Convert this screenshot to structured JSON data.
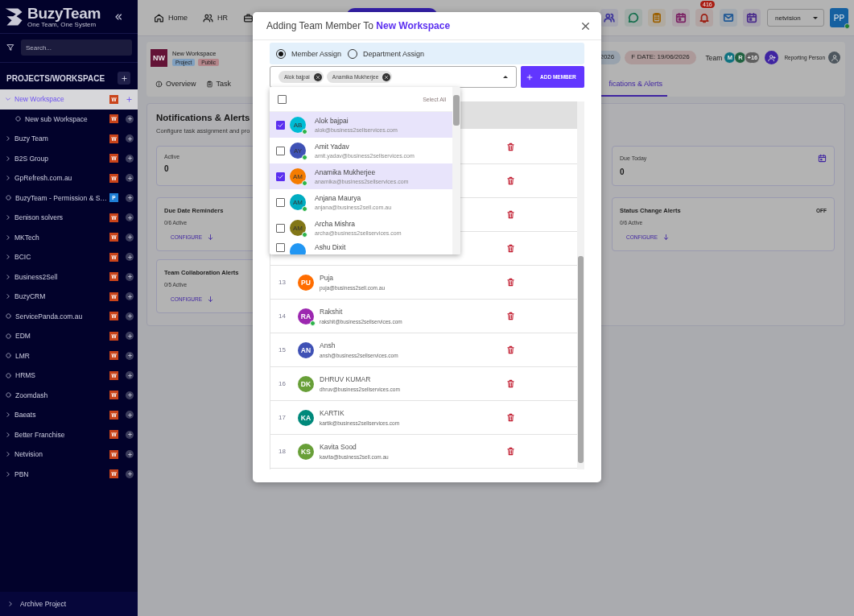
{
  "sidebar": {
    "logo_title": "BuzyTeam",
    "logo_tagline": "One Team, One System",
    "search_placeholder": "Search...",
    "section_title": "PROJECTS/WORKSPACE",
    "items": [
      {
        "kind": "folder",
        "label": "New Workspace",
        "expanded": true,
        "selected": true,
        "badge": "W",
        "color": "#c9441a",
        "children": [
          {
            "kind": "dot",
            "label": "New sub Workspace",
            "selected": false,
            "badge": "W",
            "color": "#c9441a"
          }
        ]
      },
      {
        "kind": "folder",
        "label": "Buzy Team",
        "expanded": false,
        "selected": false,
        "badge": "W",
        "color": "#c9441a"
      },
      {
        "kind": "folder",
        "label": "B2S Group",
        "expanded": false,
        "selected": false,
        "badge": "W",
        "color": "#c9441a"
      },
      {
        "kind": "folder",
        "label": "GpRefresh.com.au",
        "expanded": false,
        "selected": false,
        "badge": "W",
        "color": "#c9441a"
      },
      {
        "kind": "dot",
        "label": "BuzyTeam - Permission & S…",
        "selected": false,
        "badge": "P",
        "color": "#1f7fd6"
      },
      {
        "kind": "folder",
        "label": "Benison solvers",
        "expanded": false,
        "selected": false,
        "badge": "W",
        "color": "#c9441a"
      },
      {
        "kind": "folder",
        "label": "MKTech",
        "expanded": false,
        "selected": false,
        "badge": "W",
        "color": "#c9441a"
      },
      {
        "kind": "folder",
        "label": "BCIC",
        "expanded": false,
        "selected": false,
        "badge": "W",
        "color": "#c9441a"
      },
      {
        "kind": "folder",
        "label": "Business2Sell",
        "expanded": false,
        "selected": false,
        "badge": "W",
        "color": "#c9441a"
      },
      {
        "kind": "folder",
        "label": "BuzyCRM",
        "expanded": false,
        "selected": false,
        "badge": "W",
        "color": "#c9441a"
      },
      {
        "kind": "dot",
        "label": "ServicePanda.com.au",
        "selected": false,
        "badge": "W",
        "color": "#c9441a"
      },
      {
        "kind": "dot",
        "label": "EDM",
        "selected": false,
        "badge": "W",
        "color": "#c9441a"
      },
      {
        "kind": "dot",
        "label": "LMR",
        "selected": false,
        "badge": "W",
        "color": "#c9441a"
      },
      {
        "kind": "dot",
        "label": "HRMS",
        "selected": false,
        "badge": "W",
        "color": "#c9441a"
      },
      {
        "kind": "dot",
        "label": "Zoomdash",
        "selected": false,
        "badge": "W",
        "color": "#c9441a"
      },
      {
        "kind": "folder",
        "label": "Baeats",
        "expanded": false,
        "selected": false,
        "badge": "W",
        "color": "#c9441a"
      },
      {
        "kind": "folder",
        "label": "Better Franchise",
        "expanded": false,
        "selected": false,
        "badge": "W",
        "color": "#c9441a"
      },
      {
        "kind": "folder",
        "label": "Netvision",
        "expanded": false,
        "selected": false,
        "badge": "W",
        "color": "#c9441a"
      },
      {
        "kind": "folder",
        "label": "PBN",
        "expanded": false,
        "selected": false,
        "badge": "W",
        "color": "#c9441a"
      }
    ],
    "archive": "Archive Project"
  },
  "topbar": {
    "nav": [
      {
        "kind": "home",
        "label": "Home"
      },
      {
        "kind": "people",
        "label": "HR"
      },
      {
        "kind": "briefcase"
      }
    ],
    "icons": [
      {
        "kind": "people",
        "color": "#3f379a"
      },
      {
        "kind": "chat",
        "color": "#156e4d"
      },
      {
        "kind": "clipboard",
        "color": "#9c6000"
      },
      {
        "kind": "calendar",
        "color": "#7b2264"
      },
      {
        "kind": "bell",
        "color": "#9c2115",
        "badge": "416"
      },
      {
        "kind": "mail",
        "color": "#215995"
      },
      {
        "kind": "calendar",
        "color": "#4a2c8c"
      }
    ],
    "workspace_select": "netvision",
    "user": {
      "initials": "PP",
      "online": true
    }
  },
  "project": {
    "initials": "NW",
    "name": "New Workspace",
    "tags": [
      {
        "label": "Project",
        "color": "#7f9fbf"
      },
      {
        "label": "Public",
        "color": "#b3858a"
      }
    ],
    "start_date": "2026",
    "due_date": "F DATE: 19/06/2026",
    "team_label": "Team",
    "team": [
      {
        "initials": "M",
        "color": "#0f7280"
      },
      {
        "initials": "R",
        "color": "#206140"
      }
    ],
    "team_more": "+16",
    "reporting_label": "Reporting Person",
    "tabs": [
      {
        "label": "Overview",
        "selected": false
      },
      {
        "label": "Task",
        "selected": false
      },
      {
        "label": "fications & Alerts",
        "selected": true
      }
    ]
  },
  "panel": {
    "title": "Notifications & Alerts",
    "subtitle": "Configure task assignment and pro",
    "stats": [
      {
        "kind": "plain",
        "label": "Active",
        "value": "0"
      },
      {
        "kind": "calendar",
        "label": "Due Today",
        "value": "0"
      }
    ],
    "alerts": [
      {
        "title": "Due Date Reminders",
        "count": "0/6 Active",
        "action": "CONFIGURE"
      },
      {
        "title": "Status Change Alerts",
        "status": "OFF",
        "count": "0/6 Active",
        "action": "CONFIGURE"
      },
      {
        "title": "Team Collaboration Alerts",
        "count": "0/5 Active",
        "action": "CONFIGURE"
      }
    ]
  },
  "modal": {
    "title": "Adding Team Member To ",
    "title_highlight": "New Workspace",
    "assign_options": [
      {
        "label": "Member Assign",
        "selected": true
      },
      {
        "label": "Department Assign",
        "selected": false
      }
    ],
    "chips": [
      "Alok bajpai",
      "Anamika Mukherjee"
    ],
    "add_button": "ADD MEMBER",
    "dropdown": {
      "select_all": "Select All",
      "select_all_checked": false,
      "options": [
        {
          "initials": "AB",
          "name": "Alok bajpai",
          "email": "alok@business2sellservices.com",
          "checked": true,
          "color": "#00bcd4",
          "online": true
        },
        {
          "initials": "AY",
          "name": "Amit Yadav",
          "email": "amit.yadav@business2sellservices.com",
          "checked": false,
          "color": "#3f51b5",
          "online": true
        },
        {
          "initials": "AM",
          "name": "Anamika Mukherjee",
          "email": "anamika@business2sellservices.com",
          "checked": true,
          "color": "#f57c00",
          "online": true
        },
        {
          "initials": "AM",
          "name": "Anjana Maurya",
          "email": "anjana@business2sell.com.au",
          "checked": false,
          "color": "#00acc1",
          "online": true
        },
        {
          "initials": "AM",
          "name": "Archa Mishra",
          "email": "archa@business2sellservices.com",
          "checked": false,
          "color": "#827717",
          "online": true
        },
        {
          "name": "Ashu Dixit",
          "checked": false,
          "color": "#2196f3"
        }
      ]
    },
    "rows": [
      {
        "kind": "covered"
      },
      {
        "kind": "covered"
      },
      {
        "kind": "covered"
      },
      {
        "kind": "covered"
      },
      {
        "kind": "member",
        "number": "13",
        "initials": "PU",
        "name": "Puja",
        "email": "puja@business2sell.com.au",
        "color": "#ff6d00"
      },
      {
        "kind": "member",
        "number": "14",
        "initials": "RA",
        "name": "Rakshit",
        "email": "rakshit@business2sellservices.com",
        "color": "#9c27b0",
        "online": true
      },
      {
        "kind": "member",
        "number": "15",
        "initials": "AN",
        "name": "Ansh",
        "email": "ansh@business2sellservices.com",
        "color": "#3f51b5"
      },
      {
        "kind": "member",
        "number": "16",
        "initials": "DK",
        "name": "DHRUV KUMAR",
        "email": "dhruv@business2sellservices.com",
        "color": "#689f38"
      },
      {
        "kind": "member",
        "number": "17",
        "initials": "KA",
        "name": "KARTIK",
        "email": "kartik@business2sellservices.com",
        "color": "#00897b"
      },
      {
        "kind": "member",
        "number": "18",
        "initials": "KS",
        "name": "Kavita Sood",
        "email": "kavita@business2sell.com.au",
        "color": "#689f38"
      }
    ]
  }
}
